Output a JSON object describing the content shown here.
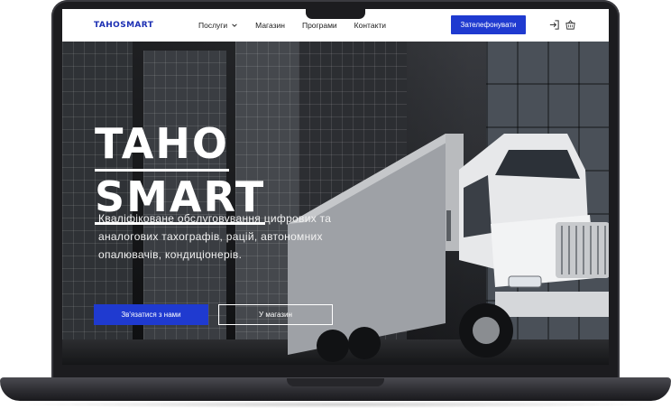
{
  "header": {
    "logo": "TAHOSMART",
    "nav": [
      {
        "label": "Послуги",
        "has_dropdown": true
      },
      {
        "label": "Магазин"
      },
      {
        "label": "Програми"
      },
      {
        "label": "Контакти"
      }
    ],
    "call_button": "Зателефонувати",
    "icons": [
      "login-icon",
      "cart-icon"
    ]
  },
  "hero": {
    "title_line1": "TAHO",
    "title_line2": "SMART",
    "subtitle": "Кваліфіковане обслуговування цифрових та аналогових тахографів, рацій, автономних опалювачів, кондиціонерів.",
    "primary_button": "Зв'язатися з нами",
    "secondary_button": "У магазин"
  },
  "colors": {
    "accent": "#1f3ad0",
    "logo": "#1c2fb3",
    "header_bg": "#ffffff",
    "laptop": "#1c1c1f"
  }
}
